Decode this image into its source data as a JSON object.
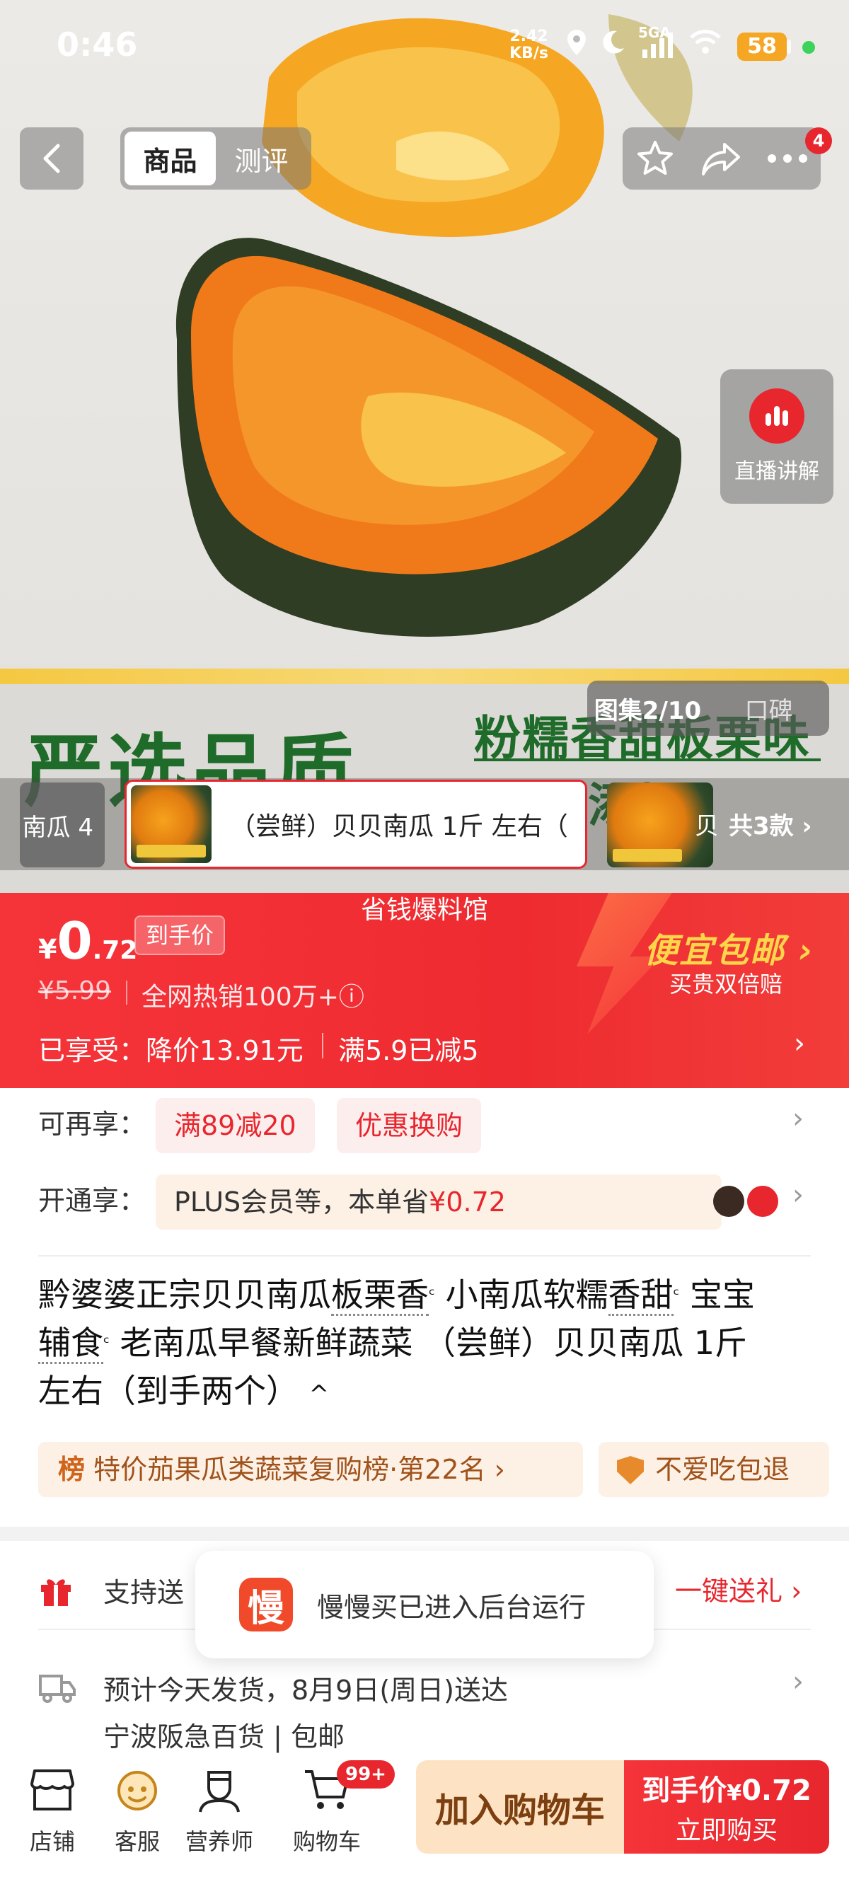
{
  "status_bar": {
    "time": "0:46",
    "net_speed_value": "2.42",
    "net_speed_unit": "KB/s",
    "network_type": "5GA",
    "battery": "58"
  },
  "top_nav": {
    "tabs": [
      {
        "label": "商品",
        "active": true
      },
      {
        "label": "测评",
        "active": false
      }
    ],
    "notification_count": "4"
  },
  "hero": {
    "slogan_left": "严选品质",
    "slogan_right_line1": "粉糯香甜板栗味",
    "slogan_right_line2": "成 无添加",
    "live_label": "直播讲解",
    "gallery_tabs": [
      {
        "label": "图集2/10",
        "active": true
      },
      {
        "label": "口碑",
        "active": false
      }
    ]
  },
  "sku_strip": {
    "prev_label": "南瓜 4",
    "current_label": "（尝鲜）贝贝南瓜 1斤 左右（",
    "next_label": "贝",
    "count_label": "共3款 ›"
  },
  "price": {
    "banner_title": "省钱爆料馆",
    "currency": "¥",
    "int": "0",
    "dec": ".72",
    "tag": "到手价",
    "original": "¥5.99",
    "hot_sales": "全网热销100万+ⓘ",
    "enjoyed": "已享受：降价13.91元",
    "full_reduce": "满5.9已减5",
    "promo_title": "便宜包邮 ›",
    "promo_sub": "买贵双倍赔"
  },
  "offers": {
    "more_label": "可再享：",
    "more_chips": [
      "满89减20",
      "优惠换购"
    ],
    "plus_label": "开通享：",
    "plus_text": "PLUS会员等，本单省",
    "plus_save": "¥0.72"
  },
  "product": {
    "title_parts": [
      "黔婆婆正宗贝贝南瓜",
      "板栗香",
      "小南瓜软糯",
      "香甜",
      "宝宝",
      "辅食",
      "老南瓜早餐新鲜蔬菜 （尝鲜）贝贝南瓜 1斤",
      "左右（到手两个）",
      "^"
    ],
    "rank_prefix": "榜",
    "rank_text": "特价茄果瓜类蔬菜复购榜·第",
    "rank_num": "22",
    "rank_suffix": "名 ›",
    "return_label": "不爱吃包退"
  },
  "service": {
    "gift_text": "支持送",
    "gift_action": "一键送礼 ›",
    "ship_line1": "预计今天发货，8月9日(周日)送达",
    "ship_line2": "宁波阪急百货  |  包邮"
  },
  "toast": {
    "logo": "慢",
    "text": "慢慢买已进入后台运行"
  },
  "bottom_bar": {
    "items": [
      {
        "label": "店铺"
      },
      {
        "label": "客服"
      },
      {
        "label": "营养师"
      },
      {
        "label": "购物车"
      }
    ],
    "cart_badge": "99+",
    "add_cart": "加入购物车",
    "buy_top": "到手价",
    "buy_price_yen": "¥",
    "buy_price": "0.72",
    "buy_bottom": "立即购买"
  },
  "colors": {
    "brand_red": "#e8262d",
    "promo_yellow": "#ffd64a",
    "chip_bg": "#fdf1e6"
  }
}
